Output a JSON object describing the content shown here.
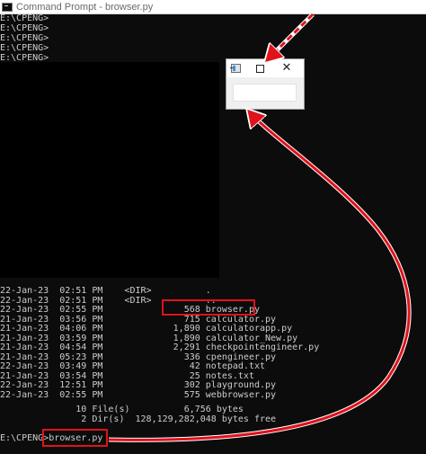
{
  "window": {
    "title": "Command Prompt - browser.py",
    "icon": "cmd-icon"
  },
  "console": {
    "prompt_lines": [
      "E:\\CPENG>",
      "E:\\CPENG>",
      "E:\\CPENG>",
      "E:\\CPENG>",
      "E:\\CPENG>"
    ],
    "listing": [
      {
        "date": "22-Jan-23",
        "time": "02:51",
        "ampm": "PM",
        "dir": "<DIR>",
        "size": "",
        "name": "."
      },
      {
        "date": "22-Jan-23",
        "time": "02:51",
        "ampm": "PM",
        "dir": "<DIR>",
        "size": "",
        "name": ".."
      },
      {
        "date": "22-Jan-23",
        "time": "02:55",
        "ampm": "PM",
        "dir": "",
        "size": "568",
        "name": "browser.py"
      },
      {
        "date": "21-Jan-23",
        "time": "03:56",
        "ampm": "PM",
        "dir": "",
        "size": "715",
        "name": "calculator.py"
      },
      {
        "date": "21-Jan-23",
        "time": "04:06",
        "ampm": "PM",
        "dir": "",
        "size": "1,890",
        "name": "calculatorapp.py"
      },
      {
        "date": "21-Jan-23",
        "time": "03:59",
        "ampm": "PM",
        "dir": "",
        "size": "1,890",
        "name": "calculator_New.py"
      },
      {
        "date": "21-Jan-23",
        "time": "04:54",
        "ampm": "PM",
        "dir": "",
        "size": "2,291",
        "name": "checkpointengineer.py"
      },
      {
        "date": "21-Jan-23",
        "time": "05:23",
        "ampm": "PM",
        "dir": "",
        "size": "336",
        "name": "cpengineer.py"
      },
      {
        "date": "22-Jan-23",
        "time": "03:49",
        "ampm": "PM",
        "dir": "",
        "size": "42",
        "name": "notepad.txt"
      },
      {
        "date": "21-Jan-23",
        "time": "03:54",
        "ampm": "PM",
        "dir": "",
        "size": "25",
        "name": "notes.txt"
      },
      {
        "date": "22-Jan-23",
        "time": "12:51",
        "ampm": "PM",
        "dir": "",
        "size": "302",
        "name": "playground.py"
      },
      {
        "date": "22-Jan-23",
        "time": "02:55",
        "ampm": "PM",
        "dir": "",
        "size": "575",
        "name": "webbrowser.py"
      }
    ],
    "summary": [
      "              10 File(s)          6,756 bytes",
      "               2 Dir(s)  128,129,282,048 bytes free"
    ],
    "command_prompt": "E:\\CPENG>",
    "command": "browser.py"
  },
  "mini_window": {
    "icons": [
      "app-icon",
      "minimize-icon",
      "maximize-icon",
      "close-icon"
    ],
    "close_glyph": "✕"
  },
  "colors": {
    "console_bg": "#0c0c0c",
    "console_text": "#cccccc",
    "annotation_red": "#e0121c"
  }
}
